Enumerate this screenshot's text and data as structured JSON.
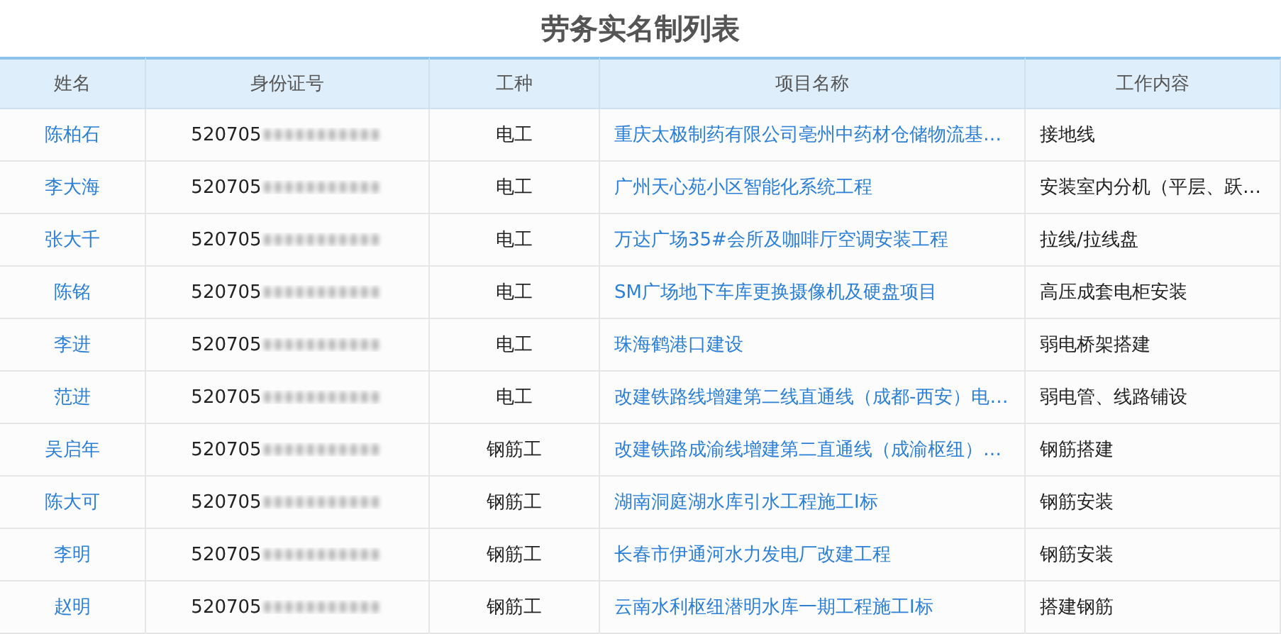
{
  "title": "劳务实名制列表",
  "table": {
    "columns": [
      "姓名",
      "身份证号",
      "工种",
      "项目名称",
      "工作内容"
    ],
    "rows": [
      {
        "name": "陈柏石",
        "id_prefix": "520705",
        "trade": "电工",
        "project": "重庆太极制药有限公司亳州中药材仓储物流基…",
        "work": "接地线"
      },
      {
        "name": "李大海",
        "id_prefix": "520705",
        "trade": "电工",
        "project": "广州天心苑小区智能化系统工程",
        "work": "安装室内分机（平层、跃…"
      },
      {
        "name": "张大千",
        "id_prefix": "520705",
        "trade": "电工",
        "project": "万达广场35#会所及咖啡厅空调安装工程",
        "work": "拉线/拉线盘"
      },
      {
        "name": "陈铭",
        "id_prefix": "520705",
        "trade": "电工",
        "project": "SM广场地下车库更换摄像机及硬盘项目",
        "work": "高压成套电柜安装"
      },
      {
        "name": "李进",
        "id_prefix": "520705",
        "trade": "电工",
        "project": "珠海鹤港口建设",
        "work": "弱电桥架搭建"
      },
      {
        "name": "范进",
        "id_prefix": "520705",
        "trade": "电工",
        "project": "改建铁路线增建第二线直通线（成都-西安）电…",
        "work": "弱电管、线路铺设"
      },
      {
        "name": "吴启年",
        "id_prefix": "520705",
        "trade": "钢筋工",
        "project": "改建铁路成渝线增建第二直通线（成渝枢纽）…",
        "work": "钢筋搭建"
      },
      {
        "name": "陈大可",
        "id_prefix": "520705",
        "trade": "钢筋工",
        "project": "湖南洞庭湖水库引水工程施工Ⅰ标",
        "work": "钢筋安装"
      },
      {
        "name": "李明",
        "id_prefix": "520705",
        "trade": "钢筋工",
        "project": "长春市伊通河水力发电厂改建工程",
        "work": "钢筋安装"
      },
      {
        "name": "赵明",
        "id_prefix": "520705",
        "trade": "钢筋工",
        "project": "云南水利枢纽潜明水库一期工程施工Ⅰ标",
        "work": "搭建钢筋"
      }
    ]
  }
}
